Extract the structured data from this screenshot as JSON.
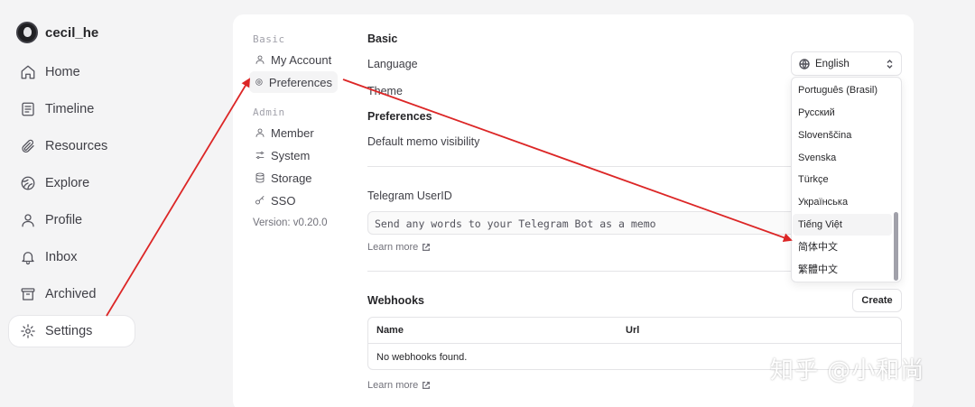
{
  "user": {
    "name": "cecil_he"
  },
  "nav": {
    "items": [
      {
        "id": "home",
        "label": "Home",
        "icon": "home-icon"
      },
      {
        "id": "timeline",
        "label": "Timeline",
        "icon": "timeline-icon"
      },
      {
        "id": "resources",
        "label": "Resources",
        "icon": "paperclip-icon"
      },
      {
        "id": "explore",
        "label": "Explore",
        "icon": "compass-icon"
      },
      {
        "id": "profile",
        "label": "Profile",
        "icon": "user-icon"
      },
      {
        "id": "inbox",
        "label": "Inbox",
        "icon": "bell-icon"
      },
      {
        "id": "archived",
        "label": "Archived",
        "icon": "archive-icon"
      },
      {
        "id": "settings",
        "label": "Settings",
        "icon": "gear-icon",
        "active": true
      }
    ]
  },
  "settings_nav": {
    "basic_label": "Basic",
    "my_account": "My Account",
    "preferences": "Preferences",
    "admin_label": "Admin",
    "member": "Member",
    "system": "System",
    "storage": "Storage",
    "sso": "SSO",
    "version": "Version: v0.20.0"
  },
  "main": {
    "basic_heading": "Basic",
    "language_label": "Language",
    "theme_label": "Theme",
    "preferences_heading": "Preferences",
    "memo_visibility_label": "Default memo visibility",
    "telegram_label": "Telegram UserID",
    "telegram_placeholder": "Send any words to your Telegram Bot as a memo",
    "learn_more": "Learn more",
    "webhooks_heading": "Webhooks",
    "create_button": "Create",
    "table_headers": {
      "name": "Name",
      "url": "Url"
    },
    "table_empty": "No webhooks found.",
    "learn_more_2": "Learn more"
  },
  "language": {
    "selected": "English",
    "options": [
      "Português (Brasil)",
      "Русский",
      "Slovenščina",
      "Svenska",
      "Türkçe",
      "Українська",
      "Tiếng Việt",
      "简体中文",
      "繁體中文"
    ],
    "hovered": "Tiếng Việt"
  },
  "watermark": "知乎 @小和尚",
  "colors": {
    "annotation_arrow": "#dc2626",
    "active_bg": "#ffffff",
    "accent_text": "#27272a"
  }
}
